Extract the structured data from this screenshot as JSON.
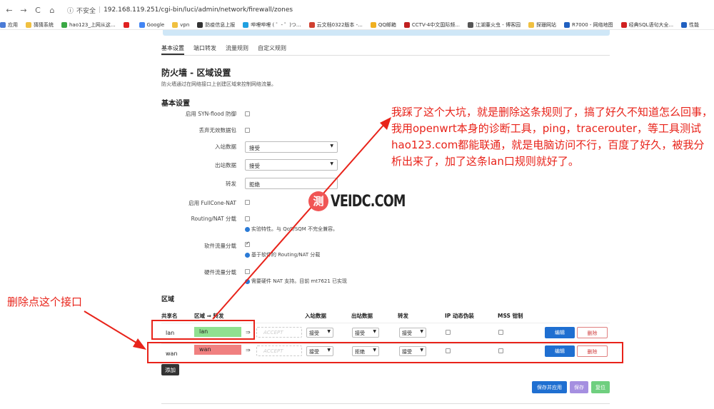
{
  "browser": {
    "back_icon": "←",
    "forward_icon": "→",
    "reload_icon": "C",
    "home_icon": "⌂",
    "security": "不安全",
    "url": "192.168.119.251/cgi-bin/luci/admin/network/firewall/zones",
    "bookmarks": [
      {
        "label": "应用",
        "color": "#4a7bd6"
      },
      {
        "label": "猜猜系统",
        "color": "#f0c040"
      },
      {
        "label": "hao123_上网从这...",
        "color": "#3aa844"
      },
      {
        "label": "",
        "color": "#e02020"
      },
      {
        "label": "Google",
        "color": "#4285f4"
      },
      {
        "label": "vpn",
        "color": "#f0c040"
      },
      {
        "label": "防疫信息上报",
        "color": "#333333"
      },
      {
        "label": "哔哩哔哩 ( ゜- ゜)つ...",
        "color": "#20a0e0"
      },
      {
        "label": "云文档0322版本 -...",
        "color": "#d04030"
      },
      {
        "label": "QQ邮箱",
        "color": "#f0b020"
      },
      {
        "label": "CCTV-4中文国际频...",
        "color": "#c02020"
      },
      {
        "label": "江湖董火虫 - 博客园",
        "color": "#555555"
      },
      {
        "label": "探珊网站",
        "color": "#f0c040"
      },
      {
        "label": "R7000 - 网络地图",
        "color": "#2060c0"
      },
      {
        "label": "经典SQL语句大全...",
        "color": "#d02020"
      },
      {
        "label": "性能",
        "color": "#2060c0"
      }
    ]
  },
  "tabs": [
    "基本设置",
    "端口转发",
    "流量规则",
    "自定义规则"
  ],
  "page": {
    "title": "防火墙 - 区域设置",
    "description": "防火墙通过在网络接口上创建区域来控制网络流量。",
    "section_basic": "基本设置"
  },
  "settings": {
    "syn_flood": "启用 SYN-flood 防御",
    "drop_invalid": "丢弃无效数据包",
    "input": {
      "label": "入站数据",
      "value": "接受"
    },
    "output": {
      "label": "出站数据",
      "value": "接受"
    },
    "forward": {
      "label": "转发",
      "value": "拒绝"
    },
    "fullcone": "启用 FullCone-NAT",
    "routing_nat": "Routing/NAT 分载",
    "routing_hint": "实验特性。与 QoS/SQM 不完全兼容。",
    "sw_offload": "软件流量分载",
    "sw_hint": "基于软件的 Routing/NAT 分载",
    "hw_offload": "硬件流量分载",
    "hw_hint": "需要硬件 NAT 支持。目前 mt7621 已实现"
  },
  "zones": {
    "title": "区域",
    "headers": [
      "共享名",
      "区域 ⇒ 转发",
      "入站数据",
      "出站数据",
      "转发",
      "IP 动态伪装",
      "MSS 钳制"
    ],
    "arrow": "⇒",
    "accept_placeholder": "ACCEPT",
    "edit": "编辑",
    "delete": "删除",
    "rows": [
      {
        "name": "lan",
        "zone": "lan",
        "color": "#90e090",
        "input": "接受",
        "output": "接受",
        "forward": "接受"
      },
      {
        "name": "wan",
        "zone": "wan",
        "color": "#f08080",
        "input": "接受",
        "output": "拒绝",
        "forward": "接受"
      }
    ]
  },
  "buttons": {
    "add": "添加",
    "save_apply": "保存并应用",
    "save": "保存",
    "reset": "复位"
  },
  "annotations": {
    "right_note": "我踩了这个大坑，就是删除这条规则了，搞了好久不知道怎么回事，我用openwrt本身的诊断工具，ping，tracerouter，等工具测试hao123.com都能联通，就是电脑访问不行，百度了好久，被我分析出来了，加了这条lan口规则就好了。",
    "left_note": "删除点这个接口",
    "color": "#e8231a",
    "watermark_logo": "测",
    "watermark_text": "VEIDC.COM"
  }
}
